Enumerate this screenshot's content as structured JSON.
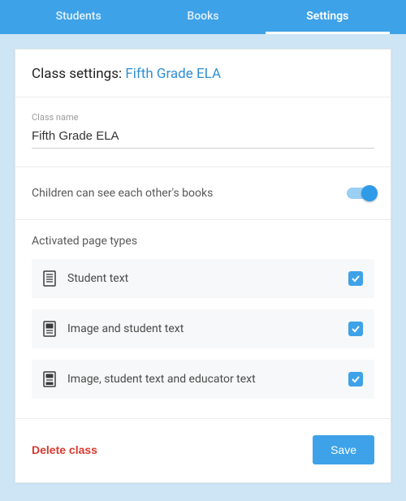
{
  "tabs": {
    "students": "Students",
    "books": "Books",
    "settings": "Settings"
  },
  "header": {
    "prefix": "Class settings: ",
    "class_name": "Fifth Grade ELA"
  },
  "class_name_field": {
    "label": "Class name",
    "value": "Fifth Grade ELA"
  },
  "toggle": {
    "label": "Children can see each other's books",
    "on": true
  },
  "page_types": {
    "title": "Activated page types",
    "items": [
      {
        "label": "Student text",
        "checked": true
      },
      {
        "label": "Image and student text",
        "checked": true
      },
      {
        "label": "Image, student text and educator text",
        "checked": true
      }
    ]
  },
  "footer": {
    "delete": "Delete class",
    "save": "Save"
  }
}
